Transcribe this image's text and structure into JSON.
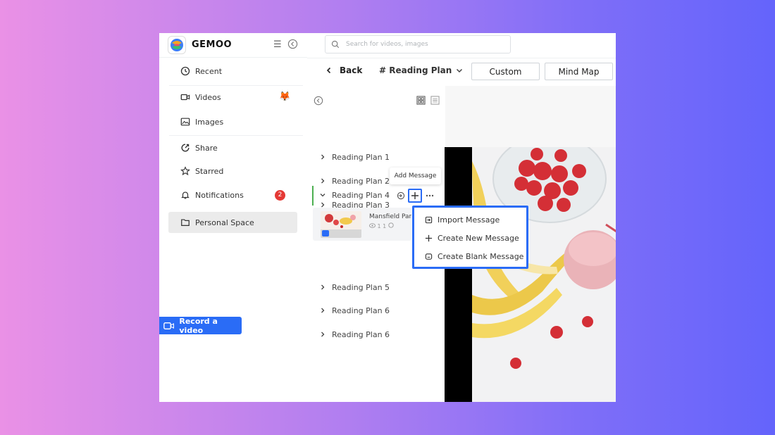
{
  "brand": {
    "name": "GEMOO"
  },
  "search": {
    "placeholder": "Search for videos, images"
  },
  "sidebar": {
    "items": [
      {
        "label": "Recent",
        "icon": "clock-icon"
      },
      {
        "label": "Videos",
        "icon": "video-icon"
      },
      {
        "label": "Images",
        "icon": "image-icon"
      },
      {
        "label": "Share",
        "icon": "share-icon"
      },
      {
        "label": "Starred",
        "icon": "star-icon"
      },
      {
        "label": "Notifications",
        "icon": "bell-icon",
        "badge": "2"
      },
      {
        "label": "Personal Space",
        "icon": "folder-icon",
        "selected": true
      }
    ],
    "record_label": "Record a video"
  },
  "header": {
    "back_label": "Back",
    "plan_title": "# Reading Plan",
    "custom_label": "Custom",
    "mindmap_label": "Mind Map"
  },
  "plans": {
    "items": [
      "Reading Plan 1",
      "Reading Plan 2",
      "Reading Plan 3",
      "Reading Plan 4",
      "Reading Plan 5",
      "Reading Plan 6",
      "Reading Plan 6"
    ],
    "message": {
      "title": "Mansfield Park",
      "stats": "1   1"
    }
  },
  "tooltip": {
    "text": "Add Message"
  },
  "dropdown": {
    "items": [
      "Import Message",
      "Create New Message",
      "Create Blank Message"
    ]
  },
  "colors": {
    "accent": "#2a6cf6",
    "badge": "#e53935",
    "active_border": "#4caf50"
  }
}
